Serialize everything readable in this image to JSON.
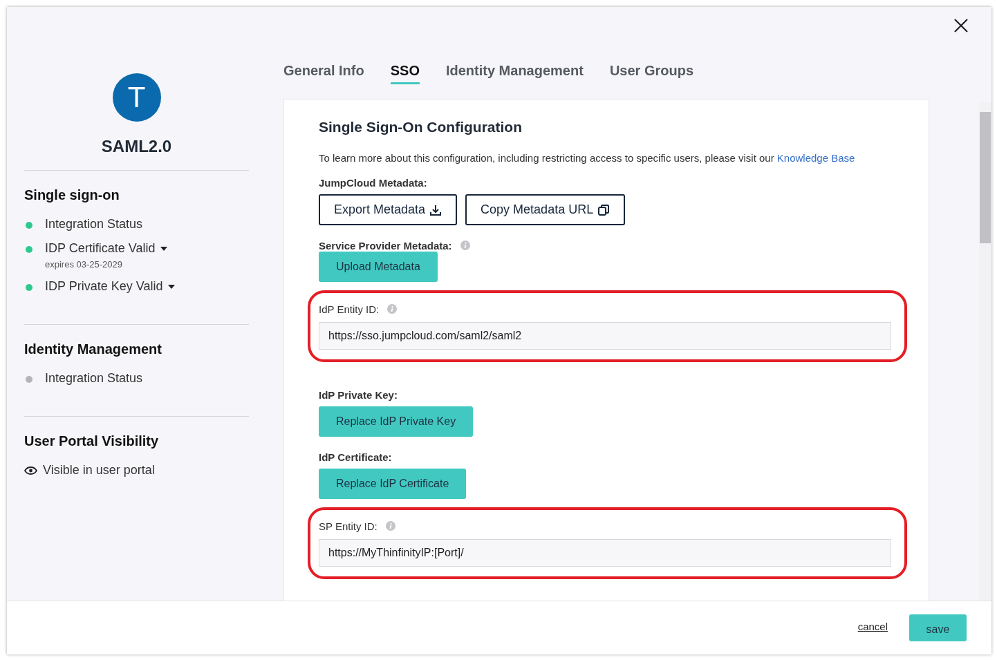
{
  "app": {
    "avatar_letter": "T",
    "name": "SAML2.0"
  },
  "sidebar_sections": [
    {
      "title": "Single sign-on",
      "items": [
        {
          "label": "Integration Status",
          "color": "#2ec990",
          "kind": "plain"
        },
        {
          "label": "IDP Certificate Valid",
          "color": "#2ec990",
          "kind": "dropdown",
          "sub": "expires 03-25-2029"
        },
        {
          "label": "IDP Private Key Valid",
          "color": "#2ec990",
          "kind": "dropdown"
        }
      ]
    },
    {
      "title": "Identity Management",
      "items": [
        {
          "label": "Integration Status",
          "color": "#b4b4b8",
          "kind": "plain"
        }
      ]
    }
  ],
  "visibility": {
    "title": "User Portal Visibility",
    "label": "Visible in user portal"
  },
  "tabs": [
    {
      "label": "General Info",
      "selected": false
    },
    {
      "label": "SSO",
      "selected": true
    },
    {
      "label": "Identity Management",
      "selected": false
    },
    {
      "label": "User Groups",
      "selected": false
    }
  ],
  "card": {
    "title": "Single Sign-On Configuration",
    "intro": "To learn more about this configuration, including restricting access to specific users, please visit our",
    "intro_link": "Knowledge Base",
    "blocks": [
      {
        "kind": "buttons",
        "label": "JumpCloud Metadata:",
        "info": false,
        "buttons": [
          {
            "label": "Export Metadata",
            "kind": "export"
          },
          {
            "label": "Copy Metadata URL",
            "kind": "copy"
          }
        ]
      },
      {
        "kind": "buttons",
        "label": "Service Provider Metadata:",
        "info": true,
        "buttons": [
          {
            "label": "Upload Metadata",
            "kind": "action"
          }
        ]
      },
      {
        "kind": "field",
        "label": "IdP Entity ID:",
        "info": true,
        "value": "https://sso.jumpcloud.com/saml2/saml2",
        "highlighted": true
      },
      {
        "kind": "buttons",
        "label": "IdP Private Key:",
        "info": false,
        "buttons": [
          {
            "label": "Replace IdP Private Key",
            "kind": "action"
          }
        ]
      },
      {
        "kind": "buttons",
        "label": "IdP Certificate:",
        "info": false,
        "buttons": [
          {
            "label": "Replace IdP Certificate",
            "kind": "action"
          }
        ]
      },
      {
        "kind": "field",
        "label": "SP Entity ID:",
        "info": true,
        "value": "https://MyThinfinityIP:[Port]/",
        "highlighted": true
      }
    ]
  },
  "footer": {
    "cancel": "cancel",
    "save": "save"
  }
}
